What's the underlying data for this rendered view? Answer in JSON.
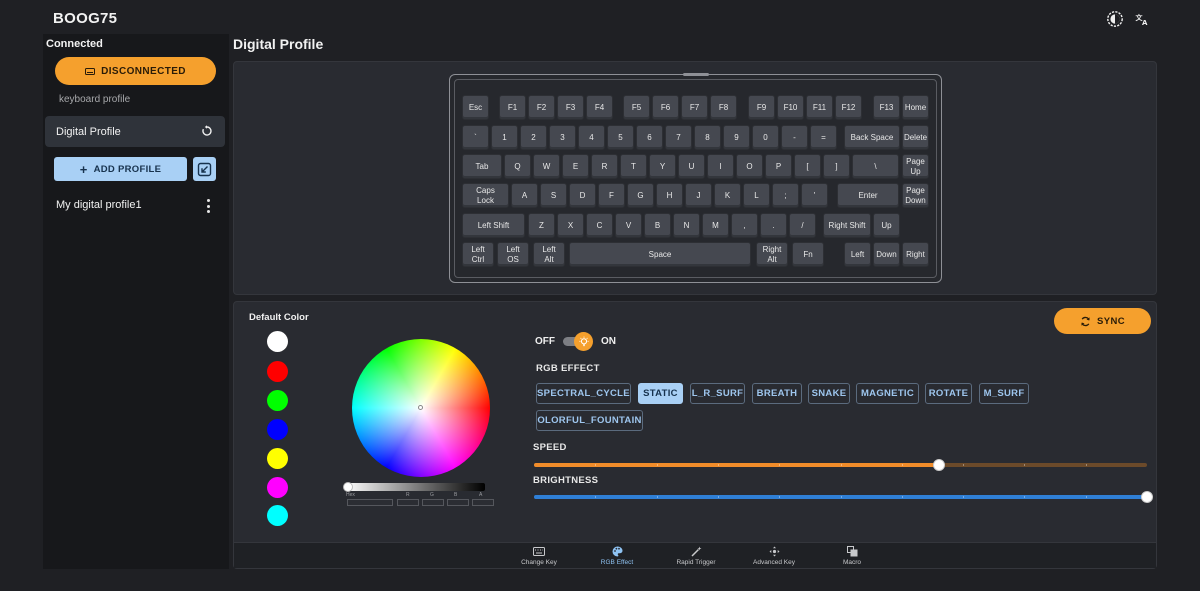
{
  "app": {
    "title": "BOOG75"
  },
  "sidebar": {
    "status": "Connected",
    "disconnect_label": "DISCONNECTED",
    "profile_kind": "keyboard profile",
    "selected_profile": "Digital Profile",
    "add_profile_label": "ADD PROFILE",
    "profiles": [
      "My digital profile1"
    ]
  },
  "main": {
    "title": "Digital Profile"
  },
  "keyboard": {
    "rows": [
      [
        {
          "label": "Esc"
        },
        {
          "label": "F1"
        },
        {
          "label": "F2"
        },
        {
          "label": "F3"
        },
        {
          "label": "F4"
        },
        {
          "label": "F5"
        },
        {
          "label": "F6"
        },
        {
          "label": "F7"
        },
        {
          "label": "F8"
        },
        {
          "label": "F9"
        },
        {
          "label": "F10"
        },
        {
          "label": "F11"
        },
        {
          "label": "F12"
        },
        {
          "label": "F13"
        },
        {
          "label": "Home"
        }
      ],
      [
        {
          "label": "`"
        },
        {
          "label": "1"
        },
        {
          "label": "2"
        },
        {
          "label": "3"
        },
        {
          "label": "4"
        },
        {
          "label": "5"
        },
        {
          "label": "6"
        },
        {
          "label": "7"
        },
        {
          "label": "8"
        },
        {
          "label": "9"
        },
        {
          "label": "0"
        },
        {
          "label": "-"
        },
        {
          "label": "="
        },
        {
          "label": "Back Space"
        },
        {
          "label": "Delete"
        }
      ],
      [
        {
          "label": "Tab"
        },
        {
          "label": "Q"
        },
        {
          "label": "W"
        },
        {
          "label": "E"
        },
        {
          "label": "R"
        },
        {
          "label": "T"
        },
        {
          "label": "Y"
        },
        {
          "label": "U"
        },
        {
          "label": "I"
        },
        {
          "label": "O"
        },
        {
          "label": "P"
        },
        {
          "label": "["
        },
        {
          "label": "]"
        },
        {
          "label": "\\"
        },
        {
          "label": "Page\nUp"
        }
      ],
      [
        {
          "label": "Caps\nLock"
        },
        {
          "label": "A"
        },
        {
          "label": "S"
        },
        {
          "label": "D"
        },
        {
          "label": "F"
        },
        {
          "label": "G"
        },
        {
          "label": "H"
        },
        {
          "label": "J"
        },
        {
          "label": "K"
        },
        {
          "label": "L"
        },
        {
          "label": ";"
        },
        {
          "label": "'"
        },
        {
          "label": "Enter"
        },
        {
          "label": "Page\nDown"
        }
      ],
      [
        {
          "label": "Left Shift"
        },
        {
          "label": "Z"
        },
        {
          "label": "X"
        },
        {
          "label": "C"
        },
        {
          "label": "V"
        },
        {
          "label": "B"
        },
        {
          "label": "N"
        },
        {
          "label": "M"
        },
        {
          "label": ","
        },
        {
          "label": "."
        },
        {
          "label": "/"
        },
        {
          "label": "Right Shift"
        },
        {
          "label": "Up"
        }
      ],
      [
        {
          "label": "Left\nCtrl"
        },
        {
          "label": "Left\nOS"
        },
        {
          "label": "Left\nAlt"
        },
        {
          "label": "Space"
        },
        {
          "label": "Right\nAlt"
        },
        {
          "label": "Fn"
        },
        {
          "label": "Left"
        },
        {
          "label": "Down"
        },
        {
          "label": "Right"
        }
      ]
    ]
  },
  "rgb": {
    "default_color_label": "Default Color",
    "default_colors": [
      "#ffffff",
      "#ff0000",
      "#00ff00",
      "#0000ff",
      "#ffff00",
      "#ff00ff",
      "#00ffff"
    ],
    "picker_labels": {
      "hex": "Hex",
      "r": "R",
      "g": "G",
      "b": "B",
      "a": "A"
    },
    "off_label": "OFF",
    "on_label": "ON",
    "enabled": true,
    "effect_label": "RGB EFFECT",
    "effects": [
      "SPECTRAL_CYCLE",
      "STATIC",
      "L_R_SURF",
      "BREATH",
      "SNAKE",
      "MAGNETIC",
      "ROTATE",
      "M_SURF",
      "OLORFUL_FOUNTAIN"
    ],
    "active_effect": "STATIC",
    "speed_label": "SPEED",
    "speed_value": 0.66,
    "brightness_label": "BRIGHTNESS",
    "brightness_value": 1.0,
    "sync_label": "SYNC"
  },
  "nav": {
    "items": [
      {
        "label": "Change Key",
        "icon": "keyboard-icon"
      },
      {
        "label": "RGB Effect",
        "icon": "palette-icon"
      },
      {
        "label": "Rapid Trigger",
        "icon": "magic-wand-icon"
      },
      {
        "label": "Advanced Key",
        "icon": "move-arrows-icon"
      },
      {
        "label": "Macro",
        "icon": "layers-icon"
      }
    ],
    "active": "RGB Effect"
  },
  "colors": {
    "accent_orange": "#f5a02d",
    "accent_blue": "#a9d0f5",
    "speed_fill": "#f08c2a",
    "brightness_fill": "#2f7fd6"
  }
}
